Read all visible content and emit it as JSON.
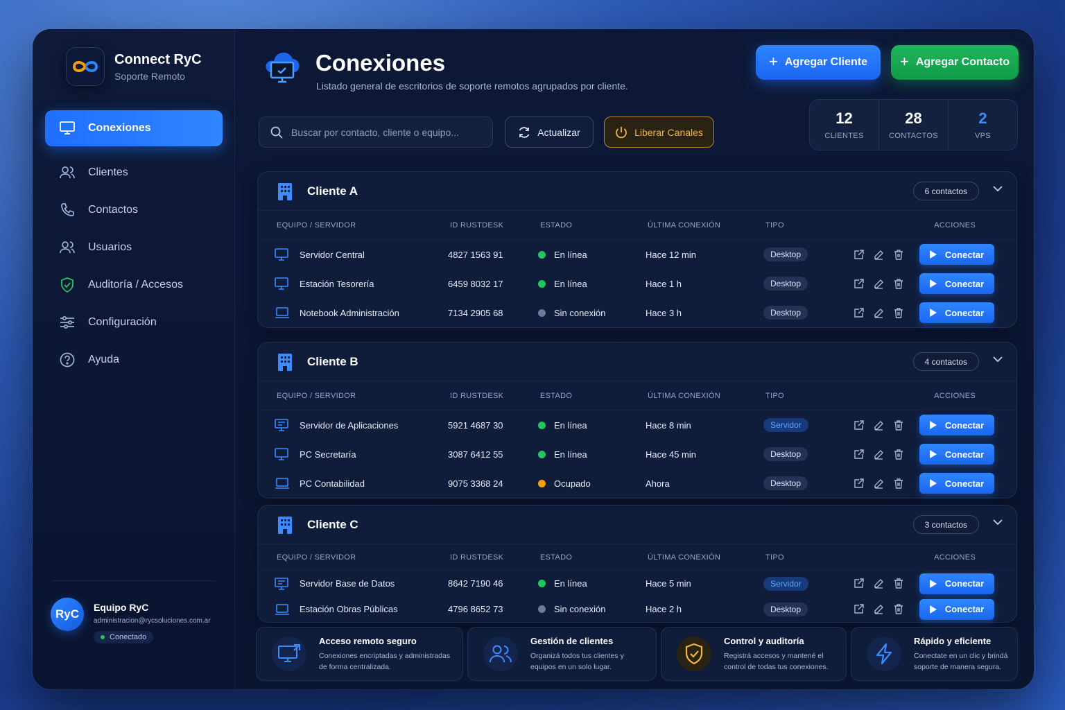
{
  "app": {
    "name": "Connect RyC",
    "subtitle": "Soporte Remoto"
  },
  "sidebar": {
    "items": [
      {
        "label": "Conexiones",
        "icon": "monitor-icon",
        "active": true
      },
      {
        "label": "Clientes",
        "icon": "users-icon"
      },
      {
        "label": "Contactos",
        "icon": "phone-icon"
      },
      {
        "label": "Usuarios",
        "icon": "user-group-icon"
      },
      {
        "label": "Auditoría / Accesos",
        "icon": "shield-check-icon"
      },
      {
        "label": "Configuración",
        "icon": "sliders-icon"
      },
      {
        "label": "Ayuda",
        "icon": "help-icon"
      }
    ]
  },
  "user": {
    "initials": "RyC",
    "name": "Equipo RyC",
    "email": "administracion@rycsoluciones.com.ar",
    "status": "Conectado"
  },
  "header": {
    "title": "Conexiones",
    "subtitle": "Listado general de escritorios de soporte remotos agrupados por cliente.",
    "add_client": "Agregar Cliente",
    "add_contact": "Agregar Contacto"
  },
  "toolbar": {
    "search_placeholder": "Buscar por contacto, cliente o equipo...",
    "refresh": "Actualizar",
    "free_channels": "Liberar Canales"
  },
  "stats": [
    {
      "value": "12",
      "label": "CLIENTES"
    },
    {
      "value": "28",
      "label": "CONTACTOS"
    },
    {
      "value": "2",
      "label": "VPS"
    }
  ],
  "columns": [
    "EQUIPO / SERVIDOR",
    "ID RUSTDESK",
    "ESTADO",
    "ÚLTIMA CONEXIÓN",
    "TIPO",
    "ACCIONES"
  ],
  "connect_label": "Conectar",
  "clients": [
    {
      "name": "Cliente A",
      "contacts": "6 contactos",
      "rows": [
        {
          "name": "Servidor Central",
          "id": "4827 1563 91",
          "status": "En línea",
          "status_color": "#22c55e",
          "last": "Hace 12 min",
          "type": "Desktop",
          "device": "monitor"
        },
        {
          "name": "Estación Tesorería",
          "id": "6459 8032 17",
          "status": "En línea",
          "status_color": "#22c55e",
          "last": "Hace 1 h",
          "type": "Desktop",
          "device": "monitor"
        },
        {
          "name": "Notebook Administración",
          "id": "7134 2905 68",
          "status": "Sin conexión",
          "status_color": "#6b7a9c",
          "last": "Hace 3 h",
          "type": "Desktop",
          "device": "laptop"
        }
      ]
    },
    {
      "name": "Cliente B",
      "contacts": "4 contactos",
      "rows": [
        {
          "name": "Servidor de Aplicaciones",
          "id": "5921 4687 30",
          "status": "En línea",
          "status_color": "#22c55e",
          "last": "Hace 8 min",
          "type": "Servidor",
          "device": "server"
        },
        {
          "name": "PC Secretaría",
          "id": "3087 6412 55",
          "status": "En línea",
          "status_color": "#22c55e",
          "last": "Hace 45 min",
          "type": "Desktop",
          "device": "monitor"
        },
        {
          "name": "PC Contabilidad",
          "id": "9075 3368 24",
          "status": "Ocupado",
          "status_color": "#f59e0b",
          "last": "Ahora",
          "type": "Desktop",
          "device": "laptop"
        }
      ]
    },
    {
      "name": "Cliente C",
      "contacts": "3 contactos",
      "rows": [
        {
          "name": "Servidor Base de Datos",
          "id": "8642 7190 46",
          "status": "En línea",
          "status_color": "#22c55e",
          "last": "Hace 5 min",
          "type": "Servidor",
          "device": "server"
        },
        {
          "name": "Estación Obras Públicas",
          "id": "4796 8652 73",
          "status": "Sin conexión",
          "status_color": "#6b7a9c",
          "last": "Hace 2 h",
          "type": "Desktop",
          "device": "laptop"
        }
      ]
    }
  ],
  "features": [
    {
      "title": "Acceso remoto seguro",
      "desc": "Conexiones encriptadas y administradas de forma centralizada.",
      "icon": "remote-monitor-icon",
      "color": "#3d8bff"
    },
    {
      "title": "Gestión de clientes",
      "desc": "Organizá todos tus clientes y equipos en un solo lugar.",
      "icon": "users-icon",
      "color": "#3d8bff"
    },
    {
      "title": "Control y auditoría",
      "desc": "Registrá accesos y mantené el control de todas tus conexiones.",
      "icon": "shield-check-icon",
      "color": "#f2b640"
    },
    {
      "title": "Rápido y eficiente",
      "desc": "Conectate en un clic y brindá soporte de manera segura.",
      "icon": "lightning-icon",
      "color": "#3d8bff"
    }
  ]
}
